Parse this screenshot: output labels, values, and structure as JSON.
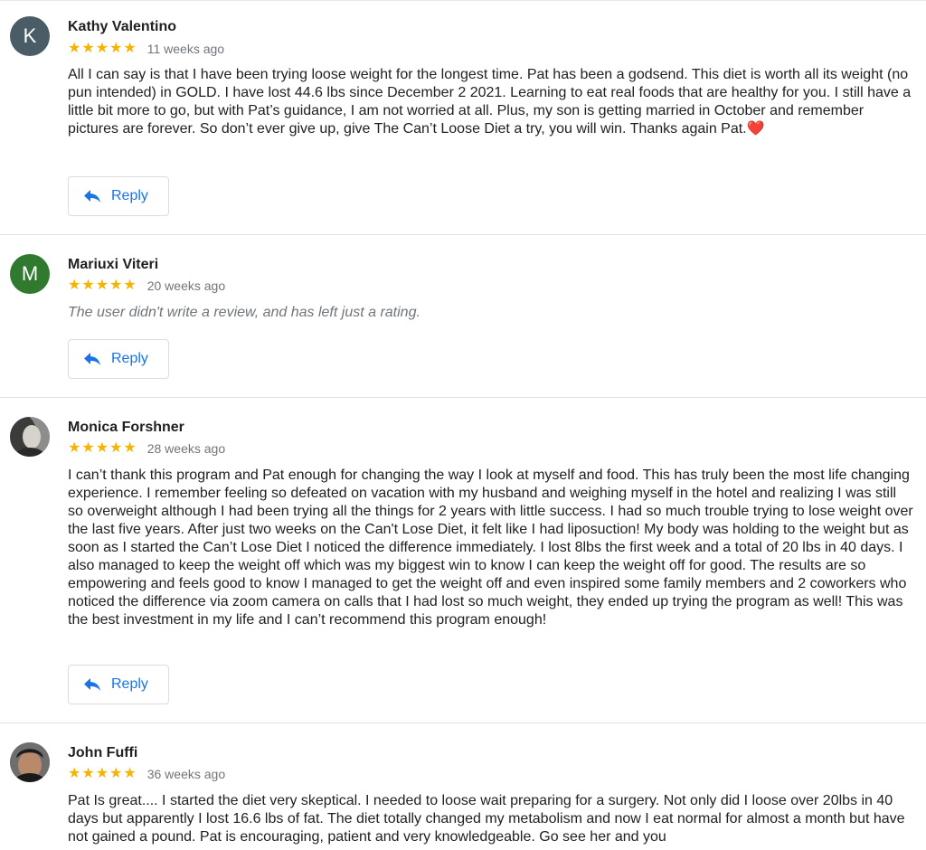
{
  "colors": {
    "star": "#f6b400",
    "reply_blue": "#1a73e8",
    "meta_gray": "#70757a",
    "avatar_k": "#4a5d66",
    "avatar_m": "#2f7a2f",
    "heart": "#e0242b"
  },
  "reviews": [
    {
      "avatar_letter": "K",
      "author": "Kathy Valentino",
      "stars": "★★★★★",
      "rating": 5,
      "time": "11 weeks ago",
      "text": "All I can say is that I have been trying loose weight for the longest time. Pat has been a godsend. This diet is worth all its weight (no pun intended) in GOLD. I have lost 44.6 lbs since December 2 2021. Learning to eat real foods that are healthy for you. I still have a little bit more to go, but with Pat’s guidance, I am not worried at all. Plus, my son is getting married in October and remember pictures are forever. So don’t ever give up, give The Can’t Loose Diet a try, you will win. Thanks again Pat.",
      "emoji": "❤️",
      "reply_label": "Reply"
    },
    {
      "avatar_letter": "M",
      "author": "Mariuxi Viteri",
      "stars": "★★★★★",
      "rating": 5,
      "time": "20 weeks ago",
      "text": "The user didn't write a review, and has left just a rating.",
      "reply_label": "Reply"
    },
    {
      "avatar_icon": "person-photo-icon",
      "author": "Monica Forshner",
      "stars": "★★★★★",
      "rating": 5,
      "time": "28 weeks ago",
      "text": "I can’t thank this program and Pat enough for changing the way I look at myself and food. This has truly been the most life changing experience. I remember feeling so defeated on vacation with my husband and weighing myself in the hotel and realizing I was still so overweight although I had been trying all the things for 2 years with little success. I had so much trouble trying to lose weight over the last five years. After just two weeks on the Can't Lose Diet, it felt like I had liposuction! My body was holding to the weight but as soon as I started the Can’t Lose Diet I noticed the difference immediately. I lost 8lbs the first week and a total of 20 lbs in 40 days. I also managed to keep the weight off which was my biggest win to know I can keep the weight off for good. The results are so empowering and feels good to know I managed to get the weight off and even inspired some family members and 2 coworkers who noticed the difference via zoom camera on calls that I had lost so much weight, they ended up trying the program as well! This was the best investment in my life and I can’t recommend this program enough!",
      "reply_label": "Reply"
    },
    {
      "avatar_icon": "person-photo-icon",
      "author": "John Fuffi",
      "stars": "★★★★★",
      "rating": 5,
      "time": "36 weeks ago",
      "text": "Pat Is great.... I started the diet very skeptical. I needed to loose wait preparing for a surgery. Not only did I loose over 20lbs in 40 days but apparently I lost 16.6 lbs of fat. The diet totally changed my metabolism and now I eat normal for almost a month but have not gained a pound. Pat is encouraging, patient and very knowledgeable. Go see her and you"
    }
  ]
}
